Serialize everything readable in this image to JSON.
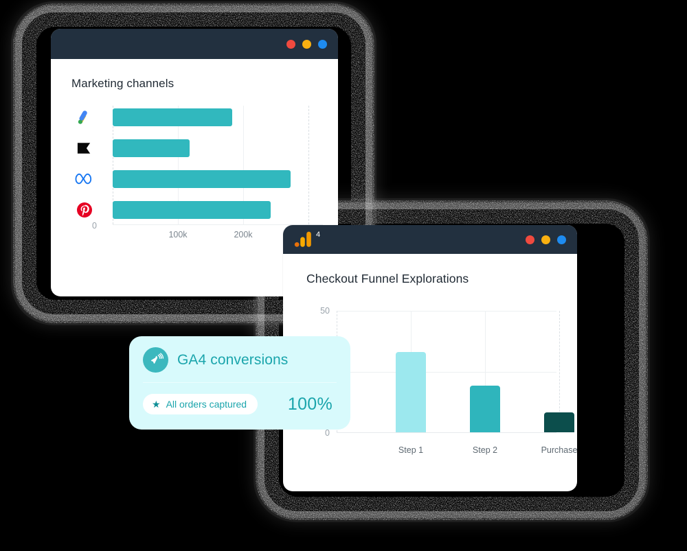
{
  "colors": {
    "background": "#000000",
    "titlebar": "#22303F",
    "bar_teal": "#31B8BE",
    "funnel_light": "#9CE8EE",
    "funnel_mid": "#2FB5BC",
    "funnel_dark": "#0C4E4C",
    "card_bg": "#D8FAFC",
    "card_text": "#1BA5AC",
    "dot_red": "#F04A3F",
    "dot_yellow": "#F9B011",
    "dot_blue": "#1E8BEF"
  },
  "marketing_window": {
    "title": "Marketing channels",
    "window_dots": [
      "close-dot",
      "minimize-dot",
      "maximize-dot"
    ]
  },
  "funnel_window": {
    "logo_label": "4",
    "title": "Checkout Funnel Explorations",
    "window_dots": [
      "close-dot",
      "minimize-dot",
      "maximize-dot"
    ]
  },
  "ga4_card": {
    "icon": "hummingbird-icon",
    "title": "GA4 conversions",
    "badge_icon": "star-icon",
    "badge_label": "All orders captured",
    "percent": "100%"
  },
  "chart_data": [
    {
      "type": "bar",
      "orientation": "horizontal",
      "title": "Marketing channels",
      "categories": [
        "Google Ads",
        "TikTok",
        "Meta",
        "Pinterest"
      ],
      "category_icons": [
        "google-ads-icon",
        "tiktok-icon",
        "meta-icon",
        "pinterest-icon"
      ],
      "values": [
        176000,
        115000,
        268000,
        238000
      ],
      "xlabel": "",
      "ylabel": "",
      "xlim": [
        0,
        290000
      ],
      "xtick_labels": [
        "0",
        "100k",
        "200k"
      ],
      "xtick_values": [
        0,
        100000,
        200000
      ],
      "grid": true,
      "legend": "none",
      "series_color": "#31B8BE"
    },
    {
      "type": "bar",
      "orientation": "vertical",
      "title": "Checkout Funnel Explorations",
      "categories": [
        "Step 1",
        "Step 2",
        "Purchase"
      ],
      "values": [
        33,
        19,
        8
      ],
      "bar_colors": [
        "#9CE8EE",
        "#2FB5BC",
        "#0C4E4C"
      ],
      "xlabel": "",
      "ylabel": "",
      "ylim": [
        0,
        50
      ],
      "ytick_labels": [
        "0",
        "50"
      ],
      "ytick_values": [
        0,
        50
      ],
      "grid": true,
      "legend": "none"
    }
  ]
}
